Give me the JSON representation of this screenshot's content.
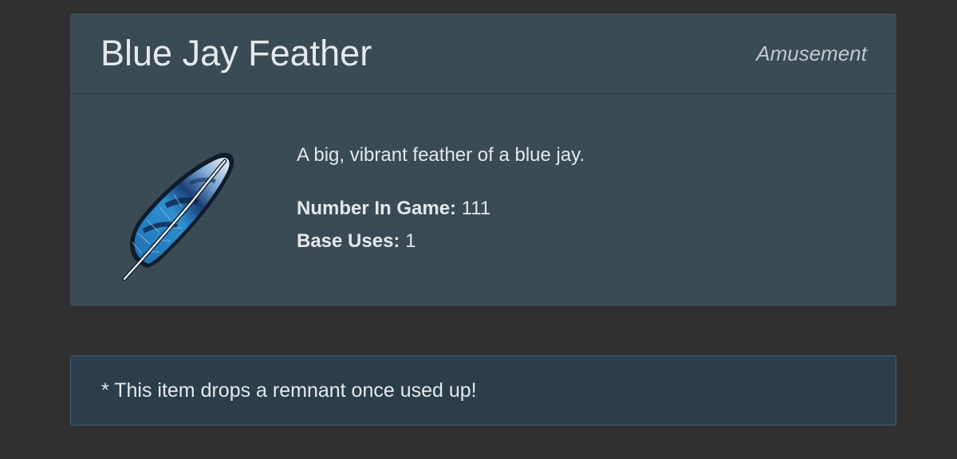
{
  "item": {
    "title": "Blue Jay Feather",
    "category": "Amusement",
    "description": "A big, vibrant feather of a blue jay.",
    "icon": "feather-icon",
    "stats": [
      {
        "label": "Number In Game:",
        "value": "111"
      },
      {
        "label": "Base Uses:",
        "value": "1"
      }
    ]
  },
  "notice": {
    "text": "* This item drops a remnant once used up!"
  },
  "colors": {
    "page_background": "#303030",
    "card_background": "#3b4b53",
    "notice_background": "#2d3e4b",
    "notice_border": "#3e6276",
    "feather_blue": "#2f8fcf",
    "feather_dark": "#0f1c2c"
  }
}
